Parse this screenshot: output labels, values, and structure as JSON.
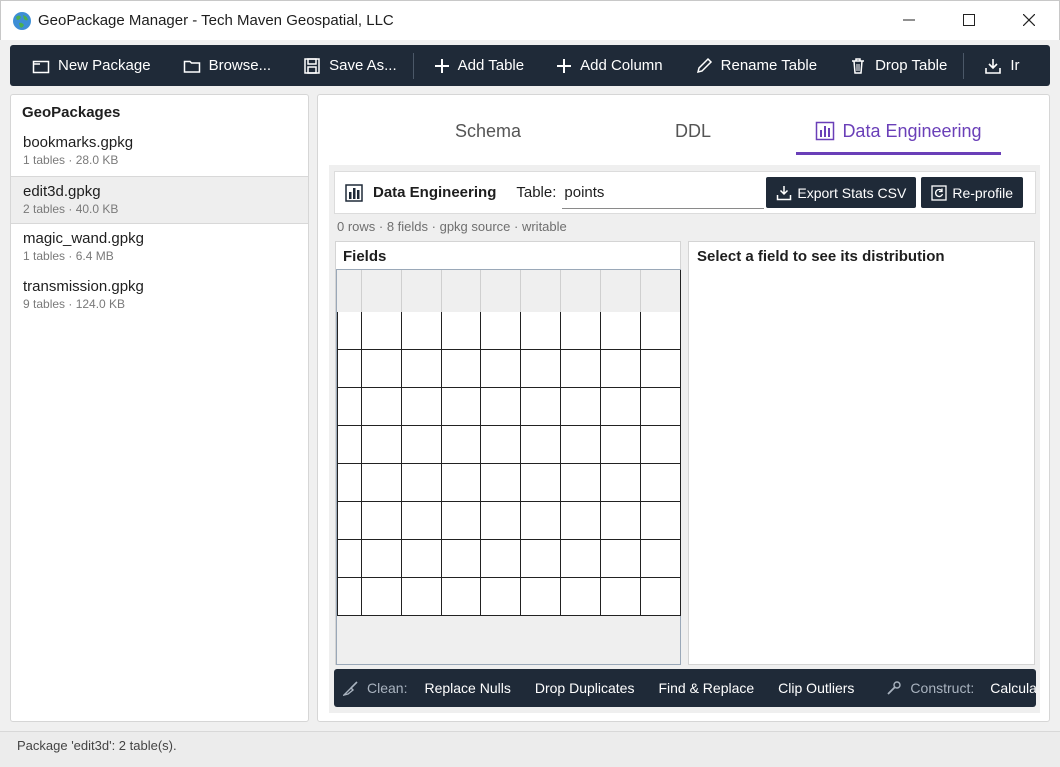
{
  "window": {
    "title": "GeoPackage Manager - Tech Maven Geospatial, LLC"
  },
  "toolbar": {
    "new_package": "New Package",
    "browse": "Browse...",
    "save_as": "Save As...",
    "add_table": "Add Table",
    "add_column": "Add Column",
    "rename_table": "Rename Table",
    "drop_table": "Drop Table",
    "import": "Ir"
  },
  "sidebar": {
    "title": "GeoPackages",
    "packages": [
      {
        "name": "bookmarks.gpkg",
        "meta": "1 tables · 28.0 KB"
      },
      {
        "name": "edit3d.gpkg",
        "meta": "2 tables · 40.0 KB"
      },
      {
        "name": "magic_wand.gpkg",
        "meta": "1 tables · 6.4 MB"
      },
      {
        "name": "transmission.gpkg",
        "meta": "9 tables · 124.0 KB"
      }
    ]
  },
  "tabs": {
    "schema": "Schema",
    "ddl": "DDL",
    "data_engineering": "Data Engineering"
  },
  "data_engineering": {
    "title": "Data Engineering",
    "table_label": "Table:",
    "table_value": "points",
    "export_stats": "Export Stats CSV",
    "reprofile": "Re-profile",
    "summary": "0 rows · 8 fields · gpkg source · writable",
    "fields_title": "Fields",
    "distribution_hint": "Select a field to see its distribution"
  },
  "actions": {
    "clean_label": "Clean:",
    "replace_nulls": "Replace Nulls",
    "drop_duplicates": "Drop Duplicates",
    "find_replace": "Find & Replace",
    "clip_outliers": "Clip Outliers",
    "construct_label": "Construct:",
    "calculate": "Calculat"
  },
  "status": {
    "text": "Package 'edit3d': 2 table(s)."
  },
  "colors": {
    "toolbar_bg": "#1f2a38",
    "accent": "#6a3fb8"
  }
}
